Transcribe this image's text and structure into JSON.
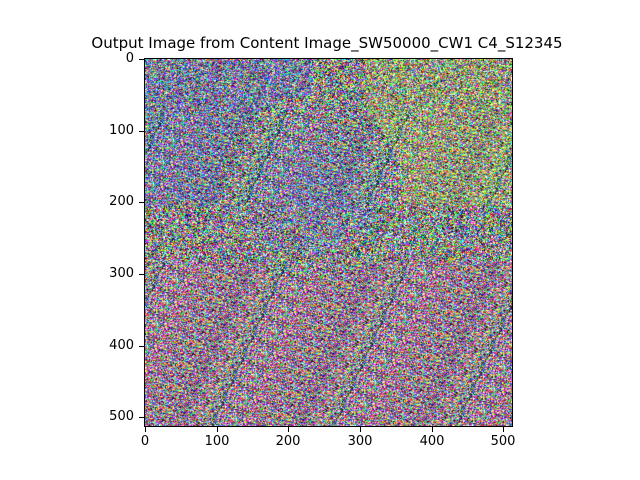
{
  "figure": {
    "title": "Output Image from Content Image_SW50000_CW1 C4_S12345",
    "image_size": [
      512,
      512
    ],
    "y_ticks": [
      "0",
      "100",
      "200",
      "300",
      "400",
      "500"
    ],
    "x_ticks": [
      "0",
      "100",
      "200",
      "300",
      "400",
      "500"
    ],
    "x_tick_values": [
      0,
      100,
      200,
      300,
      400,
      500
    ],
    "y_tick_values": [
      0,
      100,
      200,
      300,
      400,
      500
    ],
    "noise_colors": [
      "#ff2020",
      "#20ff20",
      "#2040ff",
      "#ff20ff",
      "#20ffff",
      "#ffff20",
      "#ffffff",
      "#101018"
    ],
    "hue_bias": [
      {
        "region": "upper-left",
        "color": "#3050ff"
      },
      {
        "region": "upper-right",
        "color": "#d0ff30"
      },
      {
        "region": "center",
        "color": "#4060ff"
      },
      {
        "region": "lower",
        "color": "#ff40c0"
      }
    ]
  }
}
